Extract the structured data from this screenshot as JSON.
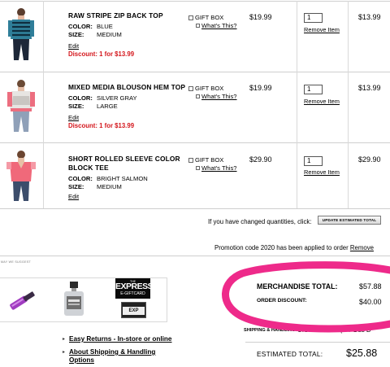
{
  "cart": {
    "items": [
      {
        "name_line1": "RAW STRIPE ZIP BACK TOP",
        "name_line2": "",
        "color_label": "COLOR:",
        "color": "BLUE",
        "size_label": "SIZE:",
        "size": "MEDIUM",
        "edit": "Edit",
        "discount": "Discount: 1 for  $13.99",
        "gift_box": "GIFT BOX",
        "whats_this": "What's This?",
        "price": "$19.99",
        "qty": "1",
        "remove": "Remove Item",
        "total": "$13.99"
      },
      {
        "name_line1": "MIXED MEDIA BLOUSON HEM TOP",
        "name_line2": "",
        "color_label": "COLOR:",
        "color": "SILVER GRAY",
        "size_label": "SIZE:",
        "size": "LARGE",
        "edit": "Edit",
        "discount": "Discount: 1 for  $13.99",
        "gift_box": "GIFT BOX",
        "whats_this": "What's This?",
        "price": "$19.99",
        "qty": "1",
        "remove": "Remove Item",
        "total": "$13.99"
      },
      {
        "name_line1": "SHORT ROLLED SLEEVE COLOR",
        "name_line2": "BLOCK TEE",
        "color_label": "COLOR:",
        "color": "BRIGHT SALMON",
        "size_label": "SIZE:",
        "size": "MEDIUM",
        "edit": "Edit",
        "discount": "",
        "gift_box": "GIFT BOX",
        "whats_this": "What's This?",
        "price": "$29.90",
        "qty": "1",
        "remove": "Remove Item",
        "total": "$29.90"
      }
    ],
    "qty_message": "If you have changed quantities, click:",
    "update_button": "UPDATE ESTIMATED TOTAL",
    "promo_text": "Promotion code 2020 has been applied to order",
    "promo_remove": "Remove"
  },
  "suggestions": {
    "label": "MAY WE SUGGEST",
    "gift_card_line1": "THE",
    "gift_card_line2": "EXPRESS",
    "gift_card_line3": "E-GIFTCARD",
    "card_text": "EXP"
  },
  "summary": {
    "merchandise_label": "MERCHANDISE TOTAL:",
    "merchandise_value": "$57.88",
    "order_discount_label": "ORDER DISCOUNT:",
    "order_discount_value": "$40.00",
    "shipping_label": "SHIPPING & HANDLING:",
    "shipping_value": "U.S. Standard (5-7 Bus D",
    "estimated_label": "ESTIMATED TOTAL:",
    "estimated_value": "$25.88"
  },
  "links": {
    "easy_returns": "Easy Returns - In-store or online",
    "about_shipping_line1": "About Shipping & Handling",
    "about_shipping_line2": "Options"
  },
  "colors": {
    "discount_red": "#d4161c",
    "highlight_circle": "#ee2a8a"
  },
  "icons": [
    "checkbox-icon",
    "help-box-icon",
    "arrow-right-icon"
  ]
}
